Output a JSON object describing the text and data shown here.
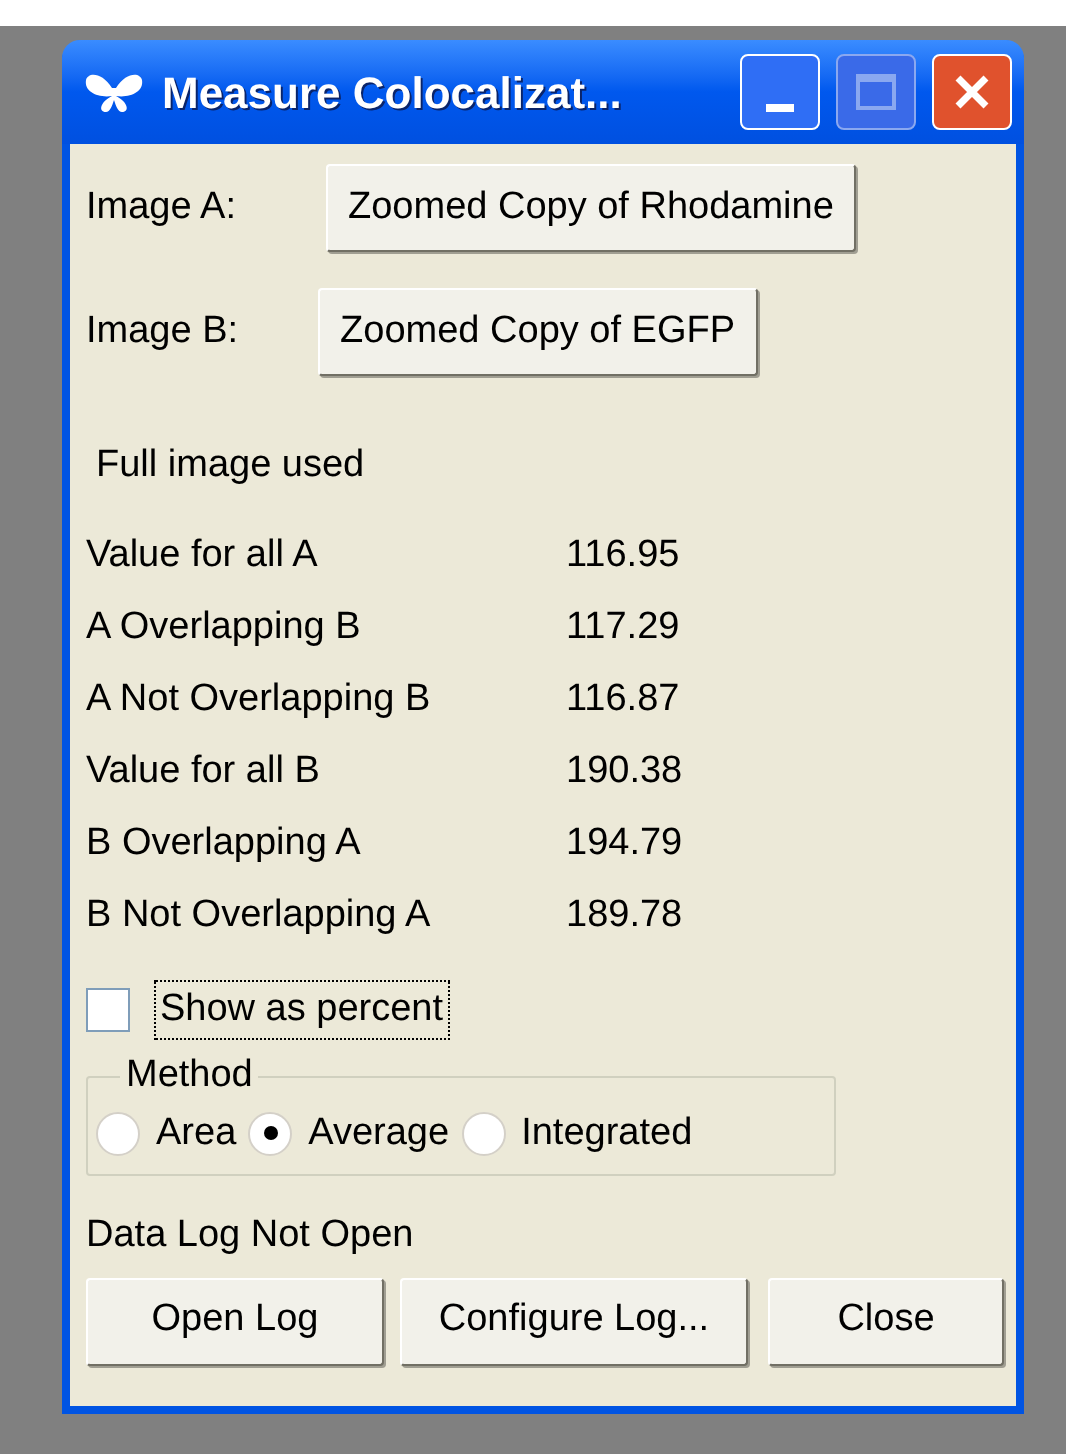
{
  "window": {
    "title": "Measure Colocalizat..."
  },
  "images": [
    {
      "label": "Image A:",
      "button": "Zoomed Copy of Rhodamine"
    },
    {
      "label": "Image B:",
      "button": "Zoomed Copy of EGFP"
    }
  ],
  "region_note": "Full image used",
  "measurements": [
    {
      "label": "Value for all A",
      "value": "116.95"
    },
    {
      "label": "A Overlapping B",
      "value": "117.29"
    },
    {
      "label": "A Not Overlapping B",
      "value": "116.87"
    },
    {
      "label": "Value for all B",
      "value": "190.38"
    },
    {
      "label": "B Overlapping A",
      "value": "194.79"
    },
    {
      "label": "B Not Overlapping A",
      "value": "189.78"
    }
  ],
  "show_as_percent": {
    "label": "Show as percent",
    "checked": false
  },
  "method": {
    "title": "Method",
    "options": [
      {
        "label": "Area",
        "selected": false
      },
      {
        "label": "Average",
        "selected": true
      },
      {
        "label": "Integrated",
        "selected": false
      }
    ]
  },
  "log_status": "Data Log Not Open",
  "buttons": [
    "Open Log",
    "Configure Log...",
    "Close"
  ]
}
